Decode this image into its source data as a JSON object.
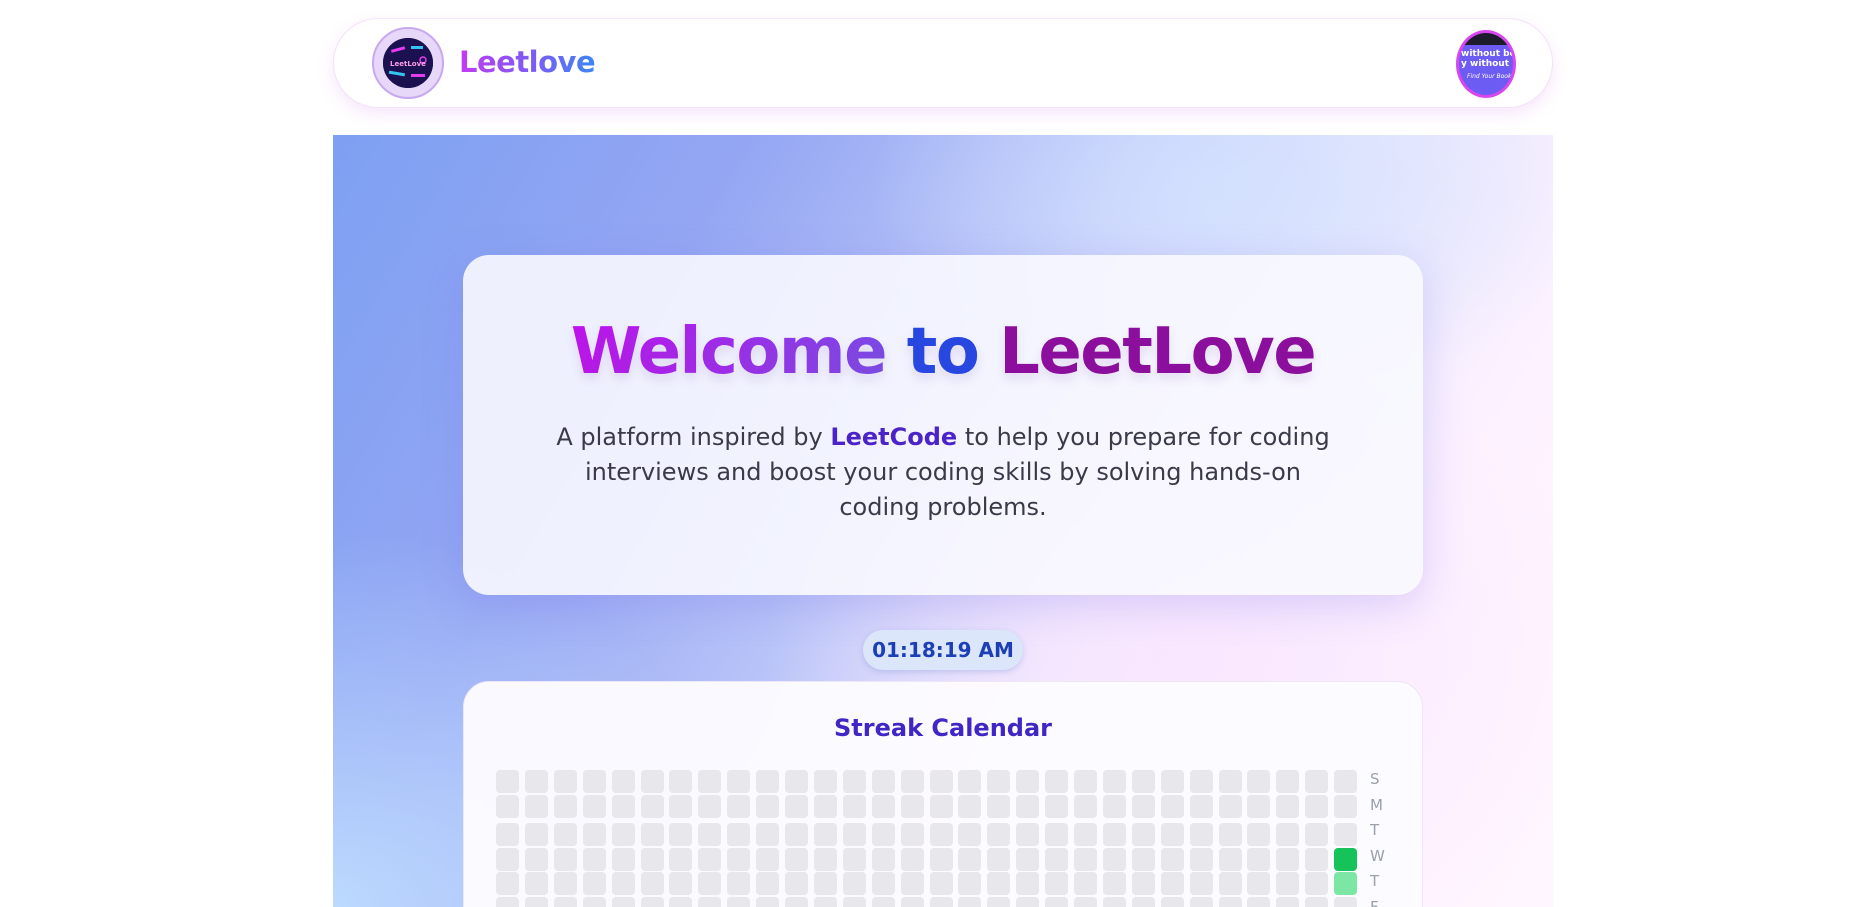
{
  "header": {
    "brand": "Leetlove",
    "logo_text": "LeetLove",
    "profile_image": {
      "line1": "without bo",
      "line2": "y without :",
      "line3": "Find Your Book"
    }
  },
  "hero": {
    "title_word1": "Welcome",
    "title_word2": "to",
    "title_word3": "LeetLove",
    "subtitle_before": "A platform inspired by",
    "subtitle_link": "LeetCode",
    "subtitle_after": "to help you prepare for coding interviews and boost your coding skills by solving hands-on coding problems."
  },
  "clock": {
    "time": "01:18:19 AM"
  },
  "streak": {
    "title": "Streak Calendar",
    "weekdays": [
      "S",
      "M",
      "T",
      "W",
      "T",
      "F"
    ],
    "weeks_visible": 30,
    "active_days": [
      {
        "week": 30,
        "day": 3,
        "level": "high",
        "color": "#16c25a"
      },
      {
        "week": 30,
        "day": 4,
        "level": "low",
        "color": "#7ce6a4"
      }
    ],
    "empty_color": "#e7e7ec"
  }
}
